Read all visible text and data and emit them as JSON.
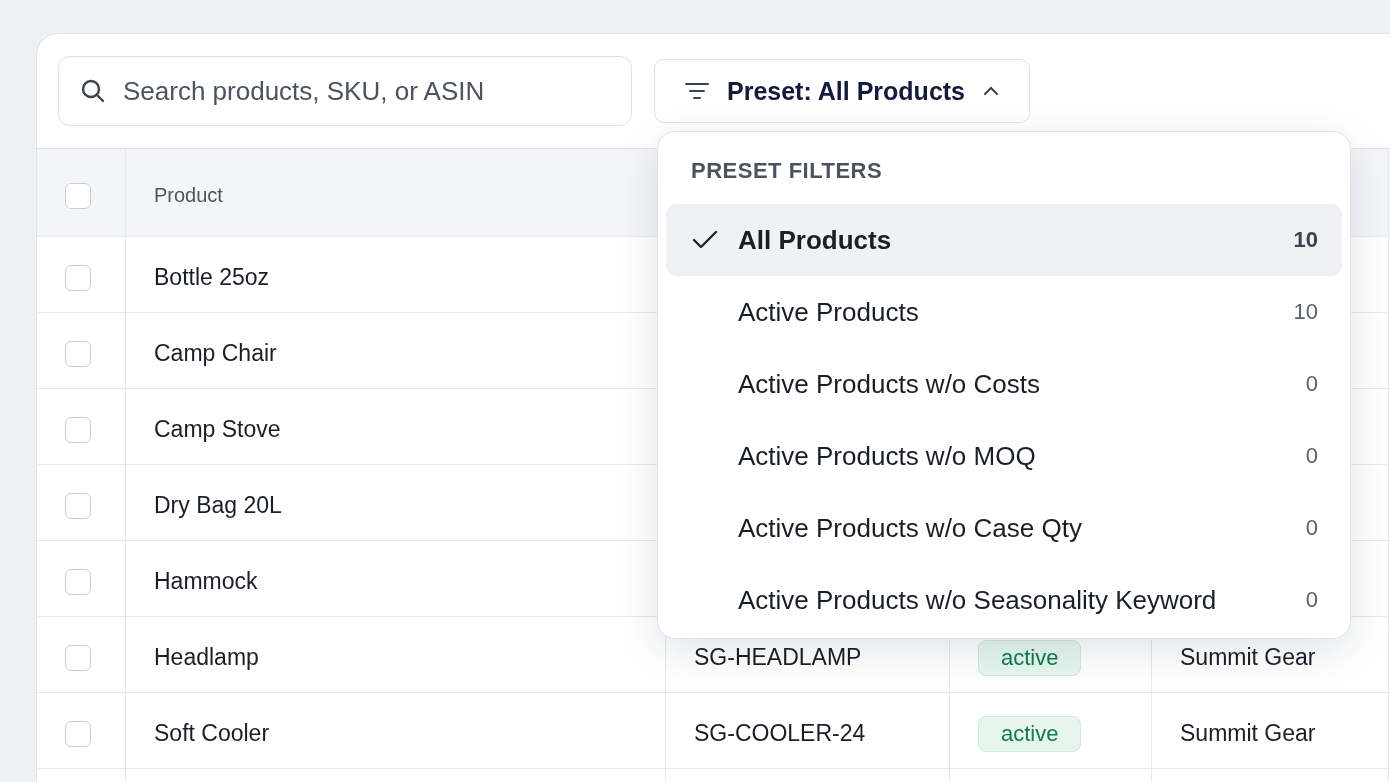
{
  "search": {
    "placeholder": "Search products, SKU, or ASIN"
  },
  "preset_button": {
    "label": "Preset: All Products",
    "expanded": true
  },
  "preset_menu": {
    "heading": "PRESET FILTERS",
    "items": [
      {
        "label": "All Products",
        "count": "10",
        "selected": true
      },
      {
        "label": "Active Products",
        "count": "10",
        "selected": false
      },
      {
        "label": "Active Products w/o Costs",
        "count": "0",
        "selected": false
      },
      {
        "label": "Active Products w/o MOQ",
        "count": "0",
        "selected": false
      },
      {
        "label": "Active Products w/o Case Qty",
        "count": "0",
        "selected": false
      },
      {
        "label": "Active Products w/o Seasonality Keyword",
        "count": "0",
        "selected": false
      }
    ]
  },
  "table": {
    "columns": [
      "Product"
    ],
    "all_checked": false,
    "rows": [
      {
        "product": "Bottle 25oz",
        "checked": false
      },
      {
        "product": "Camp Chair",
        "checked": false
      },
      {
        "product": "Camp Stove",
        "checked": false
      },
      {
        "product": "Dry Bag 20L",
        "checked": false
      },
      {
        "product": "Hammock",
        "checked": false
      },
      {
        "product": "Headlamp",
        "sku": "SG-HEADLAMP",
        "status": "active",
        "brand": "Summit Gear",
        "checked": false
      },
      {
        "product": "Soft Cooler",
        "sku": "SG-COOLER-24",
        "status": "active",
        "brand": "Summit Gear",
        "checked": false
      }
    ]
  }
}
